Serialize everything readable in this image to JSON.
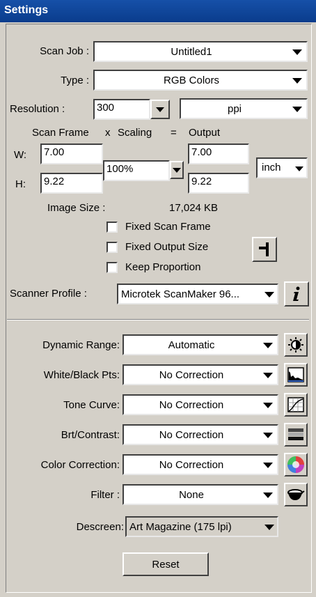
{
  "window": {
    "title": "Settings"
  },
  "scan_job": {
    "label": "Scan Job :",
    "value": "Untitled1"
  },
  "type": {
    "label": "Type :",
    "value": "RGB Colors"
  },
  "resolution": {
    "label": "Resolution :",
    "value": "300",
    "unit": "ppi"
  },
  "frame_header": {
    "scan_frame": "Scan Frame",
    "x": "x",
    "scaling": "Scaling",
    "eq": "=",
    "output": "Output"
  },
  "width": {
    "label": "W:",
    "input": "7.00",
    "output": "7.00"
  },
  "height": {
    "label": "H:",
    "input": "9.22",
    "output": "9.22"
  },
  "scaling": {
    "value": "100%"
  },
  "units": {
    "value": "inch"
  },
  "image_size": {
    "label": "Image Size :",
    "value": "17,024 KB"
  },
  "checkboxes": {
    "fixed_scan_frame": "Fixed Scan Frame",
    "fixed_output_size": "Fixed Output Size",
    "keep_proportion": "Keep Proportion"
  },
  "scanner_profile": {
    "label": "Scanner Profile :",
    "value": "Microtek ScanMaker 96..."
  },
  "corrections": [
    {
      "label": "Dynamic Range:",
      "value": "Automatic",
      "icon": "brightness-icon"
    },
    {
      "label": "White/Black Pts:",
      "value": "No Correction",
      "icon": "histogram-icon"
    },
    {
      "label": "Tone Curve:",
      "value": "No Correction",
      "icon": "curve-icon"
    },
    {
      "label": "Brt/Contrast:",
      "value": "No Correction",
      "icon": "contrast-icon"
    },
    {
      "label": "Color Correction:",
      "value": "No Correction",
      "icon": "color-wheel-icon"
    },
    {
      "label": "Filter :",
      "value": "None",
      "icon": "filter-icon"
    }
  ],
  "descreen": {
    "label": "Descreen:",
    "value": "Art Magazine (175 lpi)"
  },
  "reset": {
    "label": "Reset"
  }
}
